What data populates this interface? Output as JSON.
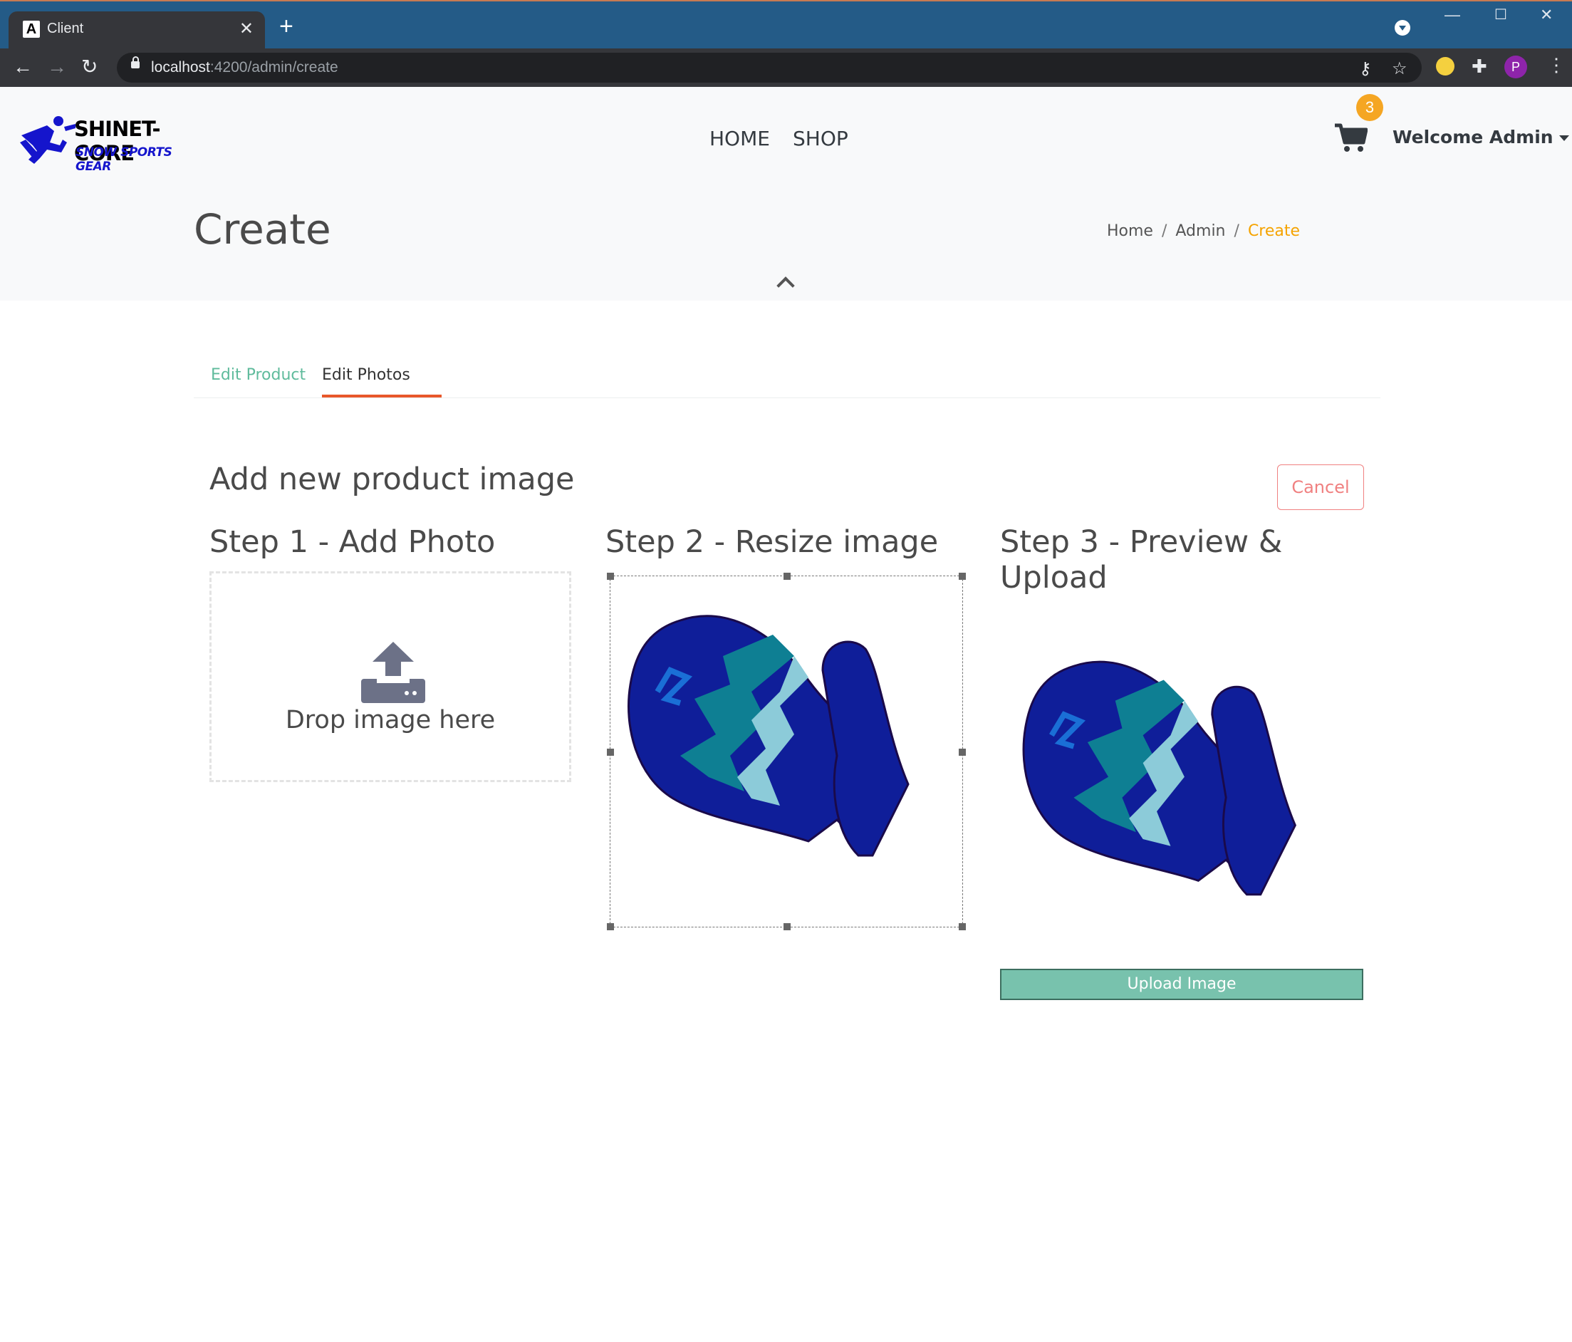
{
  "browser": {
    "tab_title": "Client",
    "tab_favicon": "A",
    "url_host": "localhost",
    "url_path": ":4200/admin/create",
    "profile_initial": "P"
  },
  "app": {
    "logo": {
      "line1": "SHINET-CORE",
      "line2": "SNOW SPORTS GEAR"
    },
    "nav": {
      "home": "HOME",
      "shop": "SHOP"
    },
    "cart_count": "3",
    "user_menu": "Welcome Admin"
  },
  "page": {
    "title": "Create",
    "breadcrumb": [
      "Home",
      "Admin",
      "Create"
    ]
  },
  "tabs": {
    "edit_product": "Edit Product",
    "edit_photos": "Edit Photos",
    "active": "Edit Photos"
  },
  "photo": {
    "heading": "Add new product image",
    "cancel": "Cancel",
    "step1": "Step 1 - Add Photo",
    "step2": "Step 2 - Resize image",
    "step3_line1": "Step 3 - Preview &",
    "step3_line2": "Upload",
    "drop_text": "Drop image here",
    "upload_button": "Upload Image"
  },
  "colors": {
    "accent_green": "#78c2ad",
    "breadcrumb_active": "#f5a300",
    "tab_underline": "#e8572a",
    "cancel": "#f08080",
    "badge": "#f5a623"
  }
}
